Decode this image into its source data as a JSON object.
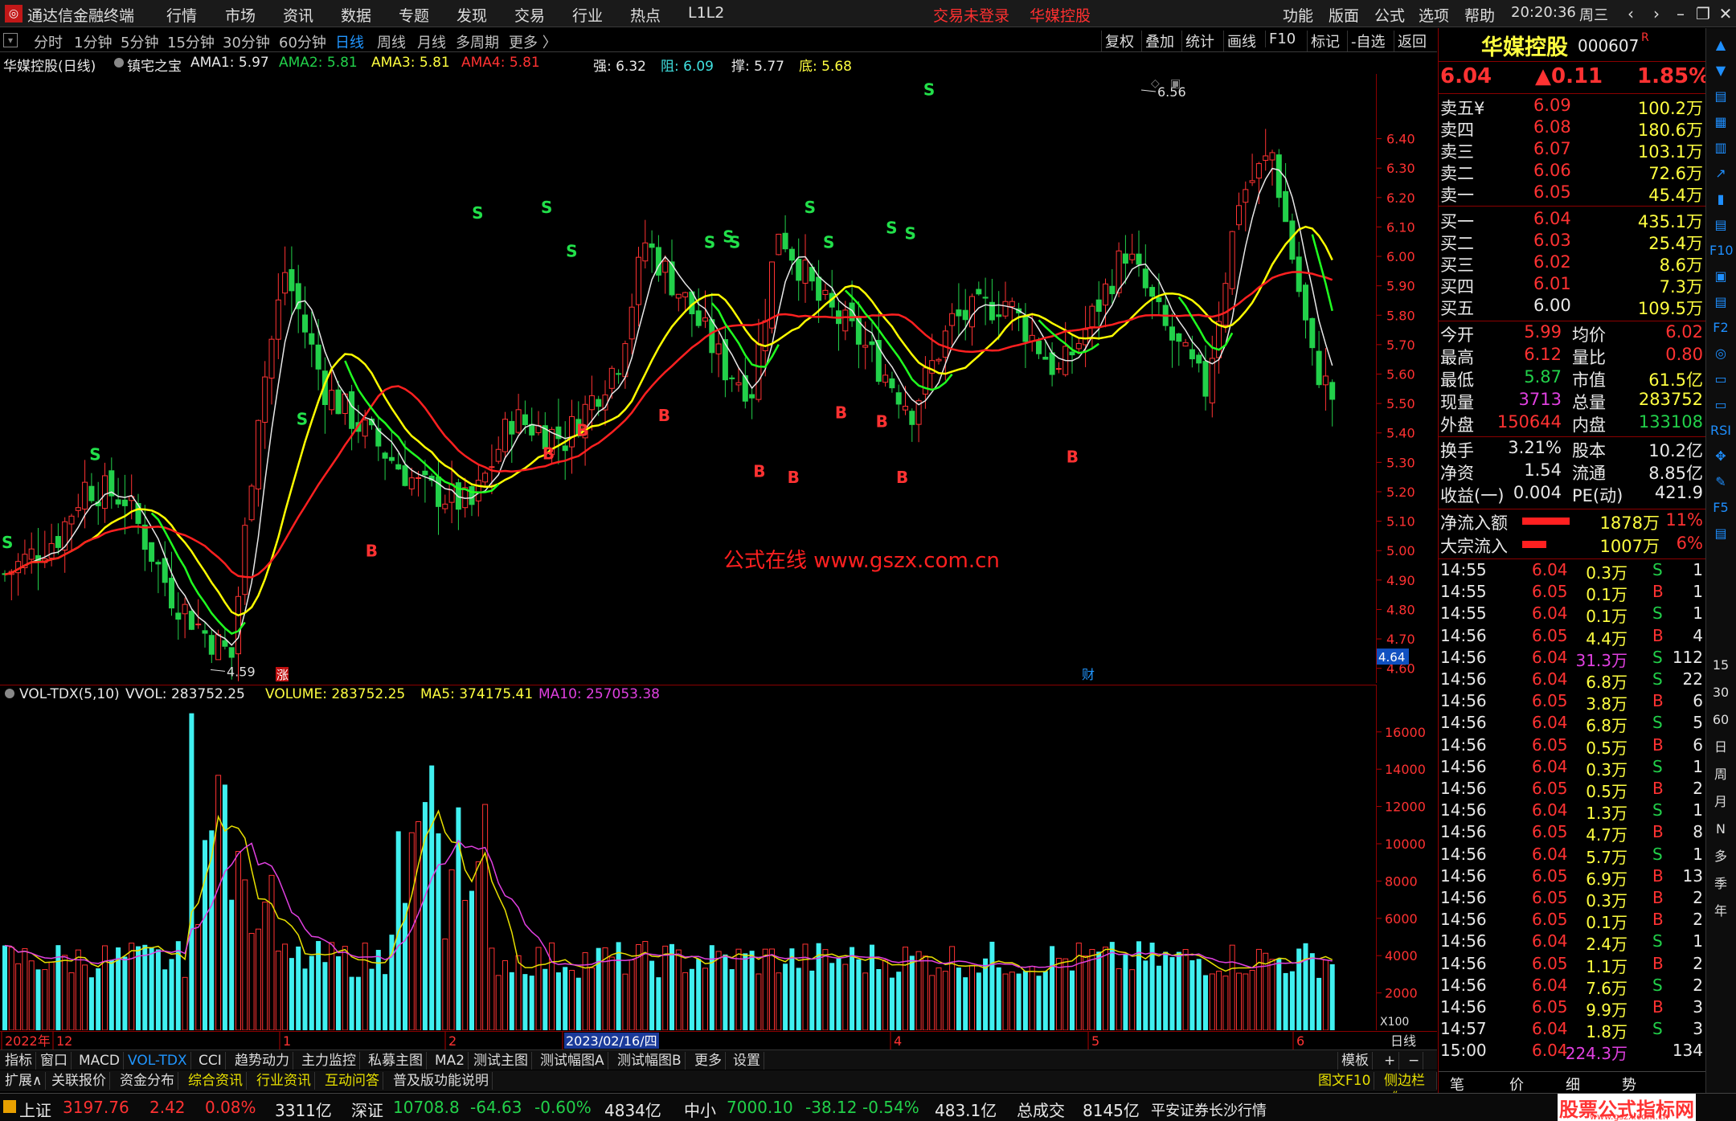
{
  "app": {
    "title": "通达信金融终端"
  },
  "menu": {
    "items": [
      "行情",
      "市场",
      "资讯",
      "数据",
      "专题",
      "发现",
      "交易",
      "行业",
      "热点",
      "L1L2"
    ],
    "login_status": "交易未登录",
    "stock_name": "华媒控股",
    "right_items": [
      "功能",
      "版面",
      "公式",
      "选项",
      "帮助"
    ],
    "time": "20:20:36",
    "weekday": "周三"
  },
  "periods": [
    "分时",
    "1分钟",
    "5分钟",
    "15分钟",
    "30分钟",
    "60分钟",
    "日线",
    "周线",
    "月线",
    "多周期",
    "更多 〉"
  ],
  "active_period": "日线",
  "tools": [
    "复权",
    "叠加",
    "统计",
    "画线",
    "F10",
    "标记",
    "-自选",
    "返回"
  ],
  "kline_info": {
    "name": "华媒控股(日线)",
    "indicator": "镇宅之宝",
    "ama1": "AMA1: 5.97",
    "ama2": "AMA2: 5.81",
    "ama3": "AMA3: 5.81",
    "ama4": "AMA4: 5.81",
    "strong": "强: 6.32",
    "resist": "阻: 6.09",
    "support": "撑: 5.77",
    "bottom": "底: 5.68"
  },
  "watermark": "公式在线  www.gszx.com.cn",
  "price_axis": [
    "6.40",
    "6.30",
    "6.20",
    "6.10",
    "6.00",
    "5.90",
    "5.80",
    "5.70",
    "5.60",
    "5.50",
    "5.40",
    "5.30",
    "5.20",
    "5.10",
    "5.00",
    "4.90",
    "4.80",
    "4.70",
    "4.60"
  ],
  "current_price_tag": "4.64",
  "price_high_label": "6.56",
  "price_low_label": "4.59",
  "event_markers": {
    "zhang": "涨",
    "cai": "财"
  },
  "vol_info": {
    "name": "VOL-TDX(5,10)",
    "vvol": "VVOL: 283752.25",
    "volume": "VOLUME: 283752.25",
    "ma5": "MA5: 374175.41",
    "ma10": "MA10: 257053.38"
  },
  "vol_axis": [
    "16000",
    "14000",
    "12000",
    "10000",
    "8000",
    "6000",
    "4000",
    "2000"
  ],
  "vol_unit": "X100",
  "date_axis": {
    "labels": [
      "2022年",
      "12",
      "1",
      "2",
      "2023/02/16/四",
      "4",
      "5",
      "6"
    ],
    "unit": "日线"
  },
  "bottom_tabs": [
    "指标",
    "窗口",
    "MACD",
    "VOL-TDX",
    "CCI",
    "趋势动力",
    "主力监控",
    "私募主图",
    "MA2",
    "测试主图",
    "测试幅图A",
    "测试幅图B",
    "更多",
    "设置"
  ],
  "active_bottom_tab": "VOL-TDX",
  "template_btn": "模板",
  "ext_tabs": [
    "扩展∧",
    "关联报价",
    "资金分布",
    "综合资讯",
    "行业资讯",
    "互动问答",
    "普及版功能说明"
  ],
  "ext_right": [
    "图文F10",
    "侧边栏《"
  ],
  "status": {
    "sh_label": "上证",
    "sh_val": "3197.76",
    "sh_chg": "2.42",
    "sh_pct": "0.08%",
    "sh_amt": "3311亿",
    "sz_label": "深证",
    "sz_val": "10708.8",
    "sz_chg": "-64.63",
    "sz_pct": "-0.60%",
    "sz_amt": "4834亿",
    "zx_label": "中小",
    "zx_val": "7000.10",
    "zx_chg": "-38.12",
    "zx_pct": "-0.54%",
    "zx_amt": "483.1亿",
    "total_label": "总成交",
    "total_amt": "8145亿",
    "broker": "平安证券长沙行情",
    "site_logo": "股票公式指标网",
    "site_url": "www.gszx.com.cn"
  },
  "quote": {
    "name": "华媒控股",
    "code": "000607",
    "flag": "R",
    "price": "6.04",
    "change": "▲0.11",
    "pct": "1.85%",
    "asks": [
      {
        "label": "卖五",
        "price": "6.09",
        "vol": "100.2万"
      },
      {
        "label": "卖四",
        "price": "6.08",
        "vol": "180.6万"
      },
      {
        "label": "卖三",
        "price": "6.07",
        "vol": "103.1万"
      },
      {
        "label": "卖二",
        "price": "6.06",
        "vol": "72.6万"
      },
      {
        "label": "卖一",
        "price": "6.05",
        "vol": "45.4万"
      }
    ],
    "ask_symbol": "¥",
    "bids": [
      {
        "label": "买一",
        "price": "6.04",
        "vol": "435.1万"
      },
      {
        "label": "买二",
        "price": "6.03",
        "vol": "25.4万"
      },
      {
        "label": "买三",
        "price": "6.02",
        "vol": "8.6万"
      },
      {
        "label": "买四",
        "price": "6.01",
        "vol": "7.3万"
      },
      {
        "label": "买五",
        "price": "6.00",
        "vol": "109.5万"
      }
    ],
    "stats": [
      {
        "l1": "今开",
        "v1": "5.99",
        "l2": "均价",
        "v2": "6.02"
      },
      {
        "l1": "最高",
        "v1": "6.12",
        "l2": "量比",
        "v2": "0.80"
      },
      {
        "l1": "最低",
        "v1": "5.87",
        "l2": "市值",
        "v2": "61.5亿"
      },
      {
        "l1": "现量",
        "v1": "3713",
        "l2": "总量",
        "v2": "283752"
      },
      {
        "l1": "外盘",
        "v1": "150644",
        "l2": "内盘",
        "v2": "133108"
      }
    ],
    "stats2": [
      {
        "l1": "换手",
        "v1": "3.21%",
        "l2": "股本",
        "v2": "10.2亿"
      },
      {
        "l1": "净资",
        "v1": "1.54",
        "l2": "流通",
        "v2": "8.85亿"
      },
      {
        "l1": "收益(一)",
        "v1": "0.004",
        "l2": "PE(动)",
        "v2": "421.9"
      }
    ],
    "flows": [
      {
        "label": "净流入额",
        "amount": "1878万",
        "pct": "11%",
        "bar": 0.9
      },
      {
        "label": "大宗流入",
        "amount": "1007万",
        "pct": "6%",
        "bar": 0.45
      }
    ],
    "ticks": [
      {
        "t": "14:55",
        "p": "6.04",
        "v": "0.3万",
        "s": "S",
        "n": "1"
      },
      {
        "t": "14:55",
        "p": "6.05",
        "v": "0.1万",
        "s": "B",
        "n": "1"
      },
      {
        "t": "14:55",
        "p": "6.04",
        "v": "0.1万",
        "s": "S",
        "n": "1"
      },
      {
        "t": "14:56",
        "p": "6.05",
        "v": "4.4万",
        "s": "B",
        "n": "4"
      },
      {
        "t": "14:56",
        "p": "6.04",
        "v": "31.3万",
        "s": "S",
        "n": "112"
      },
      {
        "t": "14:56",
        "p": "6.04",
        "v": "6.8万",
        "s": "S",
        "n": "22"
      },
      {
        "t": "14:56",
        "p": "6.05",
        "v": "3.8万",
        "s": "B",
        "n": "6"
      },
      {
        "t": "14:56",
        "p": "6.04",
        "v": "6.8万",
        "s": "S",
        "n": "5"
      },
      {
        "t": "14:56",
        "p": "6.05",
        "v": "0.5万",
        "s": "B",
        "n": "6"
      },
      {
        "t": "14:56",
        "p": "6.04",
        "v": "0.3万",
        "s": "S",
        "n": "1"
      },
      {
        "t": "14:56",
        "p": "6.05",
        "v": "0.5万",
        "s": "B",
        "n": "2"
      },
      {
        "t": "14:56",
        "p": "6.04",
        "v": "1.3万",
        "s": "S",
        "n": "1"
      },
      {
        "t": "14:56",
        "p": "6.05",
        "v": "4.7万",
        "s": "B",
        "n": "8"
      },
      {
        "t": "14:56",
        "p": "6.04",
        "v": "5.7万",
        "s": "S",
        "n": "1"
      },
      {
        "t": "14:56",
        "p": "6.05",
        "v": "6.9万",
        "s": "B",
        "n": "13"
      },
      {
        "t": "14:56",
        "p": "6.05",
        "v": "0.3万",
        "s": "B",
        "n": "2"
      },
      {
        "t": "14:56",
        "p": "6.05",
        "v": "0.1万",
        "s": "B",
        "n": "2"
      },
      {
        "t": "14:56",
        "p": "6.04",
        "v": "2.4万",
        "s": "S",
        "n": "1"
      },
      {
        "t": "14:56",
        "p": "6.05",
        "v": "1.1万",
        "s": "B",
        "n": "2"
      },
      {
        "t": "14:56",
        "p": "6.04",
        "v": "7.6万",
        "s": "S",
        "n": "2"
      },
      {
        "t": "14:56",
        "p": "6.05",
        "v": "9.9万",
        "s": "B",
        "n": "3"
      },
      {
        "t": "14:57",
        "p": "6.04",
        "v": "1.8万",
        "s": "S",
        "n": "3"
      },
      {
        "t": "15:00",
        "p": "6.04",
        "v": "224.3万",
        "s": "",
        "n": "134"
      }
    ],
    "bottom_tabs": [
      "笔",
      "价",
      "细",
      "势"
    ]
  },
  "side_icons": [
    "▲",
    "▼",
    "▤",
    "▦",
    "▥",
    "↗",
    "▮",
    "▤",
    "F10",
    "▣",
    "▤",
    "F2",
    "◎",
    "▭",
    "▭",
    "RSI",
    "✥",
    "✎",
    "F5",
    "▤",
    "15",
    "30",
    "60",
    "日",
    "周",
    "月",
    "N",
    "多",
    "季",
    "年"
  ],
  "colors": {
    "up": "#ff3232",
    "down": "#22d04a",
    "vol_up": "#ff3232",
    "vol_down": "#40f0f0",
    "ma_white": "#e8e8e8",
    "ma_yellow": "#ffff00",
    "ma_red": "#ff2020",
    "ma_green": "#20ff20"
  }
}
